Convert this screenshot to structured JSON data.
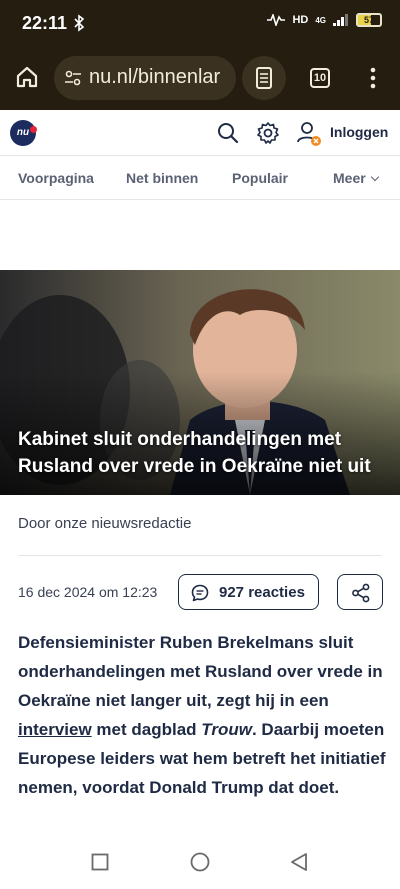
{
  "status_bar": {
    "time": "22:11",
    "network": "HD",
    "signal_type": "4G",
    "battery": "57"
  },
  "browser": {
    "url": "nu.nl/binnenlar",
    "tab_count": "10"
  },
  "site_header": {
    "logo_text": "nu",
    "login_label": "Inloggen"
  },
  "nav": {
    "items": [
      "Voorpagina",
      "Net binnen",
      "Populair",
      "Meer"
    ]
  },
  "article": {
    "title": "Kabinet sluit onderhandelingen met Rusland over vrede in Oekraïne niet uit",
    "byline": "Door onze nieuwsredactie",
    "date": "16 dec 2024 om 12:23",
    "reactions": "927 reacties",
    "intro_part1": "Defensieminister Ruben Brekelmans sluit onderhandelingen met Rusland over vrede in Oekraïne niet langer uit, zegt hij in een ",
    "intro_link": "interview",
    "intro_part2": " met dagblad ",
    "intro_italic": "Trouw",
    "intro_part3": ". Daarbij moeten Europese leiders wat hem betreft het initiatief nemen, voordat Donald Trump dat doet."
  },
  "colors": {
    "browser_chrome": "#241d10",
    "brand_navy": "#1d2c5e",
    "brand_red": "#e5243b",
    "text_dark": "#1f2a44",
    "text_muted": "#5b6274"
  },
  "icons": [
    "bluetooth-icon",
    "home-icon",
    "tune-icon",
    "reader-mode-icon",
    "tabs-icon",
    "overflow-menu-icon",
    "search-icon",
    "gear-icon",
    "user-icon",
    "comment-icon",
    "share-icon",
    "recent-apps-icon",
    "home-circle-icon",
    "back-icon"
  ]
}
